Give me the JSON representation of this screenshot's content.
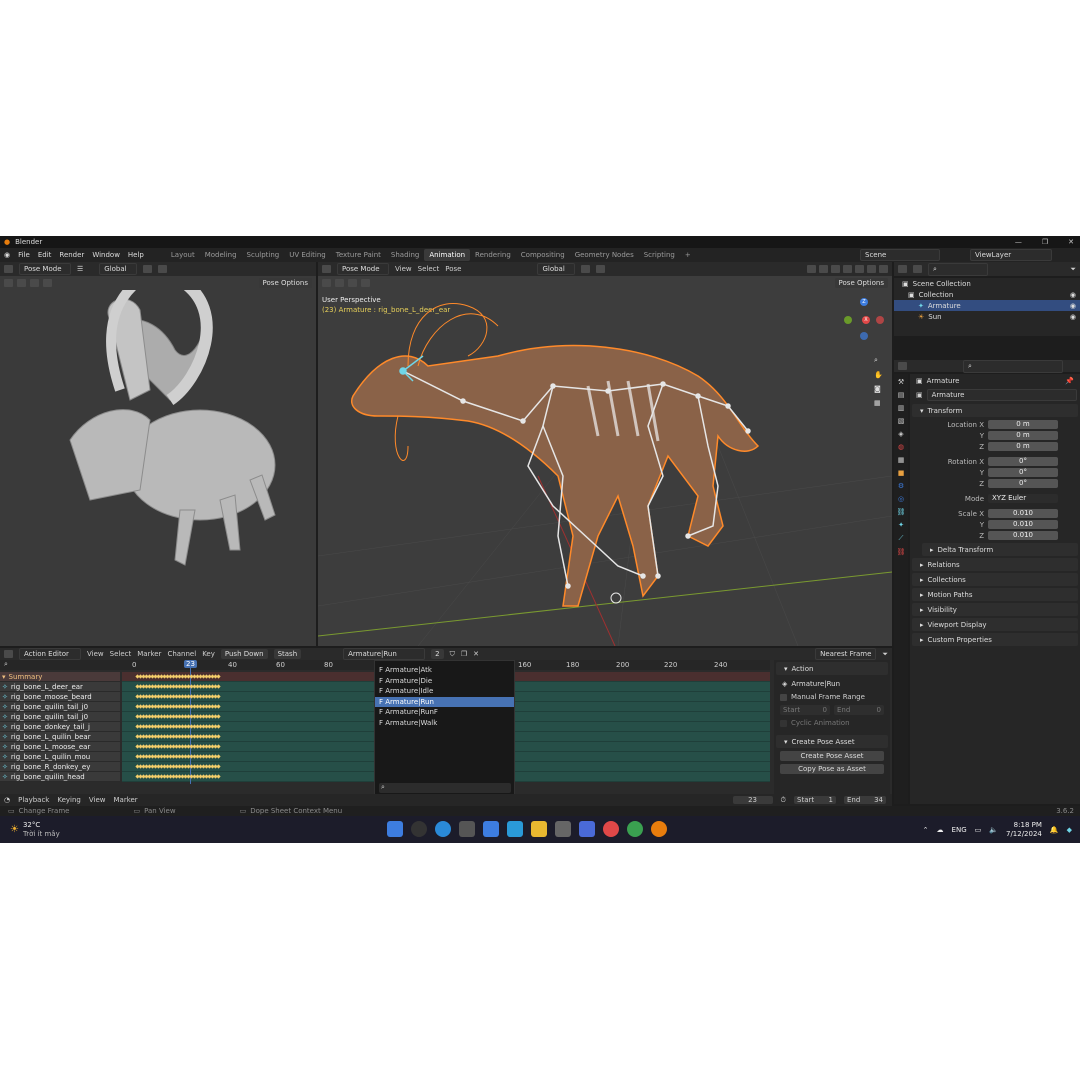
{
  "app": {
    "title": "Blender",
    "version": "3.6.2"
  },
  "menu": [
    "File",
    "Edit",
    "Render",
    "Window",
    "Help"
  ],
  "workspaces": [
    {
      "label": "Layout"
    },
    {
      "label": "Modeling"
    },
    {
      "label": "Sculpting"
    },
    {
      "label": "UV Editing"
    },
    {
      "label": "Texture Paint"
    },
    {
      "label": "Shading"
    },
    {
      "label": "Animation",
      "active": true
    },
    {
      "label": "Rendering"
    },
    {
      "label": "Compositing"
    },
    {
      "label": "Geometry Nodes"
    },
    {
      "label": "Scripting"
    }
  ],
  "scene": {
    "name": "Scene",
    "view_layer": "ViewLayer"
  },
  "left_viewport": {
    "mode": "Pose Mode",
    "orientation": "Global",
    "pose_options": "Pose Options"
  },
  "main_viewport": {
    "mode": "Pose Mode",
    "menu": [
      "View",
      "Select",
      "Pose"
    ],
    "orientation": "Global",
    "pose_options": "Pose Options",
    "perspective": "User Perspective",
    "active_info": "(23) Armature : rig_bone_L_deer_ear",
    "gizmo": {
      "x": "X",
      "y": "Y",
      "z": "Z"
    }
  },
  "outliner": {
    "rows": [
      {
        "label": "Scene Collection",
        "indent": 0
      },
      {
        "label": "Collection",
        "indent": 1
      },
      {
        "label": "Armature",
        "indent": 2,
        "selected": true
      },
      {
        "label": "Sun",
        "indent": 2
      }
    ]
  },
  "properties": {
    "object_name": "Armature",
    "data_name": "Armature",
    "transform_label": "Transform",
    "location": {
      "label": "Location X",
      "x": "0 m",
      "y": "0 m",
      "z": "0 m"
    },
    "rotation": {
      "label": "Rotation X",
      "x": "0°",
      "y": "0°",
      "z": "0°"
    },
    "mode_label": "Mode",
    "mode_value": "XYZ Euler",
    "scale": {
      "label": "Scale X",
      "x": "0.010",
      "y": "0.010",
      "z": "0.010"
    },
    "axis_y": "Y",
    "axis_z": "Z",
    "sections": [
      "Delta Transform",
      "Relations",
      "Collections",
      "Motion Paths",
      "Visibility",
      "Viewport Display",
      "Custom Properties"
    ]
  },
  "dopesheet": {
    "editor": "Action Editor",
    "menu": [
      "View",
      "Select",
      "Marker",
      "Channel",
      "Key"
    ],
    "push_down": "Push Down",
    "stash": "Stash",
    "action": "Armature|Run",
    "users": "2",
    "snap": "Nearest Frame",
    "ruler": [
      "0",
      "23",
      "40",
      "60",
      "80",
      "160",
      "180",
      "200",
      "220",
      "240"
    ],
    "summary": "Summary",
    "channels": [
      "rig_bone_L_deer_ear",
      "rig_bone_moose_beard",
      "rig_bone_quilin_tail_j0",
      "rig_bone_quilin_tail_j0",
      "rig_bone_donkey_tail_j",
      "rig_bone_L_quilin_bear",
      "rig_bone_L_moose_ear",
      "rig_bone_L_quilin_mou",
      "rig_bone_R_donkey_ey",
      "rig_bone_quilin_head"
    ]
  },
  "action_popup": {
    "items": [
      "Armature|Atk",
      "Armature|Die",
      "Armature|Idle",
      "Armature|Run",
      "Armature|RunF",
      "Armature|Walk"
    ],
    "selected_index": 3,
    "prefix": "F"
  },
  "side_panel": {
    "action_header": "Action",
    "action_name": "Armature|Run",
    "manual_range": "Manual Frame Range",
    "start": "Start",
    "start_val": "0",
    "end": "End",
    "end_val": "0",
    "cyclic": "Cyclic Animation",
    "create_pose_header": "Create Pose Asset",
    "create_pose_btn": "Create Pose Asset",
    "copy_pose_btn": "Copy Pose as Asset"
  },
  "timeline": {
    "menu": [
      "Playback",
      "Keying",
      "View",
      "Marker"
    ],
    "current_frame": "23",
    "start_label": "Start",
    "start": "1",
    "end_label": "End",
    "end": "34"
  },
  "hints": {
    "left": "Change Frame",
    "mid": "Pan View",
    "right": "Dope Sheet Context Menu"
  },
  "taskbar": {
    "weather_temp": "32°C",
    "weather_text": "Trời ít mây",
    "lang": "ENG",
    "time": "8:18 PM",
    "date": "7/12/2024"
  },
  "colors": {
    "accent": "#4772b3",
    "selection_orange": "#ff8a2a",
    "keyframe": "#f3cd6a"
  }
}
